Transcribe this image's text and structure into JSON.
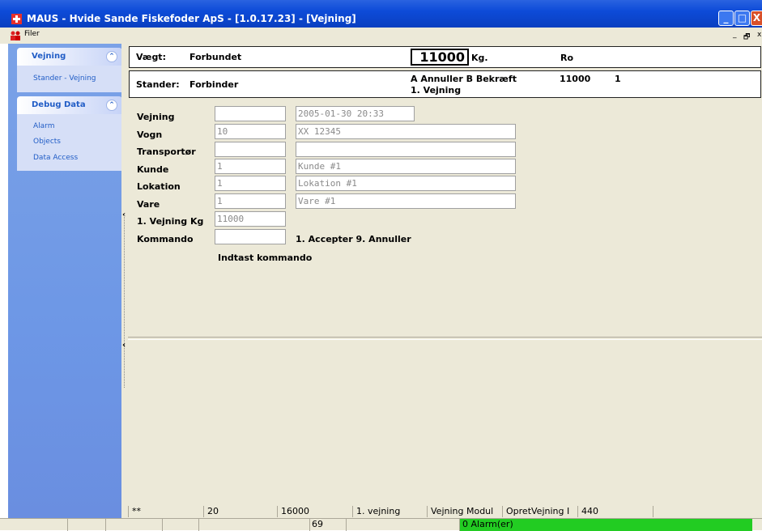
{
  "window": {
    "title": "MAUS - Hvide Sande Fiskefoder ApS - [1.0.17.23] - [Vejning]",
    "min_glyph": "_",
    "max_glyph": "□",
    "close_glyph": "X"
  },
  "menubar": {
    "file_label": "Filer",
    "mdi_min": "_",
    "mdi_restore": "🗗",
    "mdi_close": "x"
  },
  "sidebar": {
    "groups": [
      {
        "title": "Vejning",
        "items": [
          "Stander - Vejning"
        ]
      },
      {
        "title": "Debug Data",
        "items": [
          "Alarm",
          "Objects",
          "Data Access"
        ]
      }
    ],
    "collapse_glyph": "⌃"
  },
  "scale": {
    "vaegt_label": "Vægt:",
    "status": "Forbundet",
    "weight": "11000",
    "unit": "Kg.",
    "state": "Ro"
  },
  "stander": {
    "label": "Stander:",
    "status": "Forbinder",
    "commands": "A Annuller B Bekræft",
    "step": "1. Vejning",
    "weight": "11000",
    "count": "1"
  },
  "form": {
    "fields": [
      {
        "label": "Vejning",
        "code": "",
        "text": "2005-01-30 20:33"
      },
      {
        "label": "Vogn",
        "code": "10",
        "text": "XX 12345"
      },
      {
        "label": "Transportør",
        "code": "",
        "text": ""
      },
      {
        "label": "Kunde",
        "code": "1",
        "text": "Kunde #1"
      },
      {
        "label": "Lokation",
        "code": "1",
        "text": "Lokation #1"
      },
      {
        "label": "Vare",
        "code": "1",
        "text": "Vare #1"
      },
      {
        "label": "1. Vejning Kg",
        "code": "11000"
      },
      {
        "label": "Kommando",
        "code": ""
      }
    ],
    "command_options": "1. Accepter  9. Annuller",
    "prompt": "Indtast kommando"
  },
  "statusbar_inner": [
    "**",
    "20",
    "16000",
    "1. vejning",
    "Vejning Modul",
    "OpretVejning I",
    "440",
    ""
  ],
  "statusbar_bottom": {
    "cells": [
      "",
      "",
      "",
      "",
      "",
      "69",
      ""
    ],
    "alarm": "0 Alarm(er)"
  },
  "colors": {
    "titlebar": "#0d4bd8",
    "sidebar": "#6d97e6",
    "panel": "#ece9d8",
    "alarm_ok": "#22cc22"
  }
}
